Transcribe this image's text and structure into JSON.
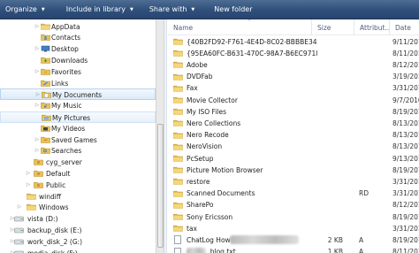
{
  "toolbar": {
    "organize": "Organize",
    "include": "Include in library",
    "share": "Share with",
    "new_folder": "New folder"
  },
  "nav": {
    "items": [
      {
        "label": "AppData",
        "expander": "collapsed",
        "type": "folder"
      },
      {
        "label": "Contacts",
        "expander": "none",
        "type": "contacts"
      },
      {
        "label": "Desktop",
        "expander": "collapsed",
        "type": "desktop"
      },
      {
        "label": "Downloads",
        "expander": "none",
        "type": "downloads"
      },
      {
        "label": "Favorites",
        "expander": "collapsed",
        "type": "favorites"
      },
      {
        "label": "Links",
        "expander": "none",
        "type": "links"
      },
      {
        "label": "My Documents",
        "expander": "collapsed",
        "type": "documents",
        "state": "selected"
      },
      {
        "label": "My Music",
        "expander": "collapsed",
        "type": "music"
      },
      {
        "label": "My Pictures",
        "expander": "none",
        "type": "pictures",
        "state": "hover"
      },
      {
        "label": "My Videos",
        "expander": "none",
        "type": "videos"
      },
      {
        "label": "Saved Games",
        "expander": "collapsed",
        "type": "games"
      },
      {
        "label": "Searches",
        "expander": "collapsed",
        "type": "searches"
      },
      {
        "label": "cyg_server",
        "expander": "none",
        "type": "user"
      },
      {
        "label": "Default",
        "expander": "collapsed",
        "type": "user"
      },
      {
        "label": "Public",
        "expander": "collapsed",
        "type": "user"
      },
      {
        "label": "windiff",
        "expander": "none",
        "type": "folder"
      },
      {
        "label": "Windows",
        "expander": "collapsed",
        "type": "folder"
      },
      {
        "label": "vista (D:)",
        "expander": "collapsed",
        "type": "drive"
      },
      {
        "label": "backup_disk (E:)",
        "expander": "collapsed",
        "type": "drive"
      },
      {
        "label": "work_disk_2 (G:)",
        "expander": "collapsed",
        "type": "drive"
      },
      {
        "label": "media_disk (F:)",
        "expander": "collapsed",
        "type": "drive"
      }
    ]
  },
  "columns": {
    "name": "Name",
    "size": "Size",
    "attributes": "Attribut...",
    "date": "Date"
  },
  "files": [
    {
      "name": "{40B2FD92-F761-4E4D-8C02-BBBBE34119...",
      "size": "",
      "attr": "",
      "date": "9/11/201",
      "type": "folder"
    },
    {
      "name": "{95EA60FC-B631-470C-98A7-B6EC9718EE...",
      "size": "",
      "attr": "",
      "date": "8/11/201",
      "type": "folder"
    },
    {
      "name": "Adobe",
      "size": "",
      "attr": "",
      "date": "8/12/201",
      "type": "folder"
    },
    {
      "name": "DVDFab",
      "size": "",
      "attr": "",
      "date": "3/19/201",
      "type": "folder"
    },
    {
      "name": "Fax",
      "size": "",
      "attr": "",
      "date": "3/31/201",
      "type": "folder"
    },
    {
      "name": "Movie Collector",
      "size": "",
      "attr": "",
      "date": "9/7/2010",
      "type": "folder"
    },
    {
      "name": "My ISO Files",
      "size": "",
      "attr": "",
      "date": "8/19/201",
      "type": "folder"
    },
    {
      "name": "Nero Collections",
      "size": "",
      "attr": "",
      "date": "8/13/201",
      "type": "folder"
    },
    {
      "name": "Nero Recode",
      "size": "",
      "attr": "",
      "date": "8/13/201",
      "type": "folder"
    },
    {
      "name": "NeroVision",
      "size": "",
      "attr": "",
      "date": "8/13/201",
      "type": "folder"
    },
    {
      "name": "PcSetup",
      "size": "",
      "attr": "",
      "date": "9/13/201",
      "type": "folder"
    },
    {
      "name": "Picture Motion Browser",
      "size": "",
      "attr": "",
      "date": "8/19/201",
      "type": "folder"
    },
    {
      "name": "restore",
      "size": "",
      "attr": "",
      "date": "3/31/201",
      "type": "folder"
    },
    {
      "name": "Scanned Documents",
      "size": "",
      "attr": "RD",
      "date": "3/31/201",
      "type": "folder"
    },
    {
      "name": "SharePo",
      "size": "",
      "attr": "",
      "date": "8/12/201",
      "type": "folder"
    },
    {
      "name": "Sony Ericsson",
      "size": "",
      "attr": "",
      "date": "8/19/201",
      "type": "folder"
    },
    {
      "name": "tax",
      "size": "",
      "attr": "",
      "date": "3/31/201",
      "type": "folder"
    },
    {
      "name": "ChatLog How",
      "size": "2 KB",
      "attr": "A",
      "date": "8/19/201",
      "type": "doc",
      "redacted": true
    },
    {
      "name": "_blog.txt",
      "size": "1 KB",
      "attr": "A",
      "date": "8/11/201",
      "type": "txt",
      "redacted_prefix": true
    }
  ],
  "colors": {
    "toolbar_top": "#4d6d94",
    "toolbar_bottom": "#284570",
    "folder": "#e8c25a",
    "selected_bg": "#dbeaf8",
    "header_text": "#4c607a"
  }
}
